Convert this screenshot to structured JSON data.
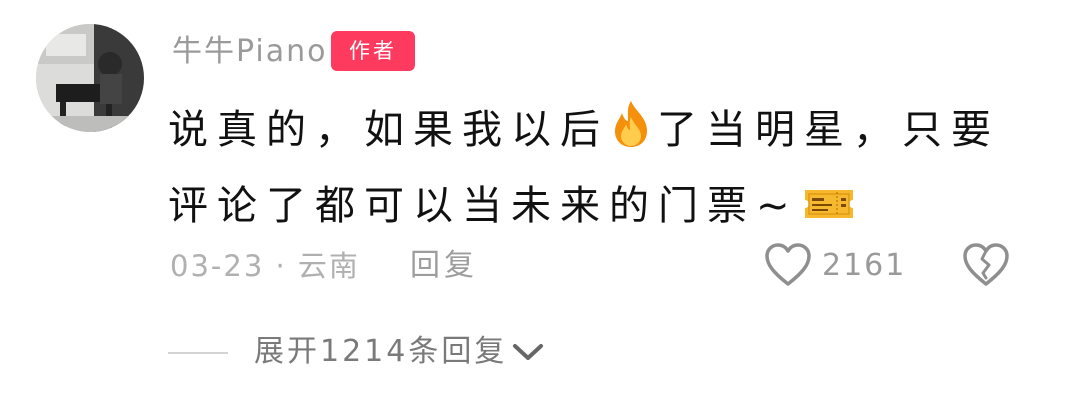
{
  "comment": {
    "username": "牛牛Piano",
    "author_badge": "作者",
    "badge_color": "#fe3b5e",
    "text_part1": "说真的，如果我以后",
    "text_emoji1": "fire-emoji",
    "text_part2": "了当明星，只要评论了都可以当未来的门票~",
    "text_emoji2": "ticket-emoji",
    "date_location": "03-23 · 云南",
    "reply_label": "回复",
    "like_icon": "heart-icon",
    "like_count": "2161",
    "dislike_icon": "broken-heart-icon",
    "expand_label": "展开1214条回复",
    "expand_icon": "chevron-down-icon"
  }
}
